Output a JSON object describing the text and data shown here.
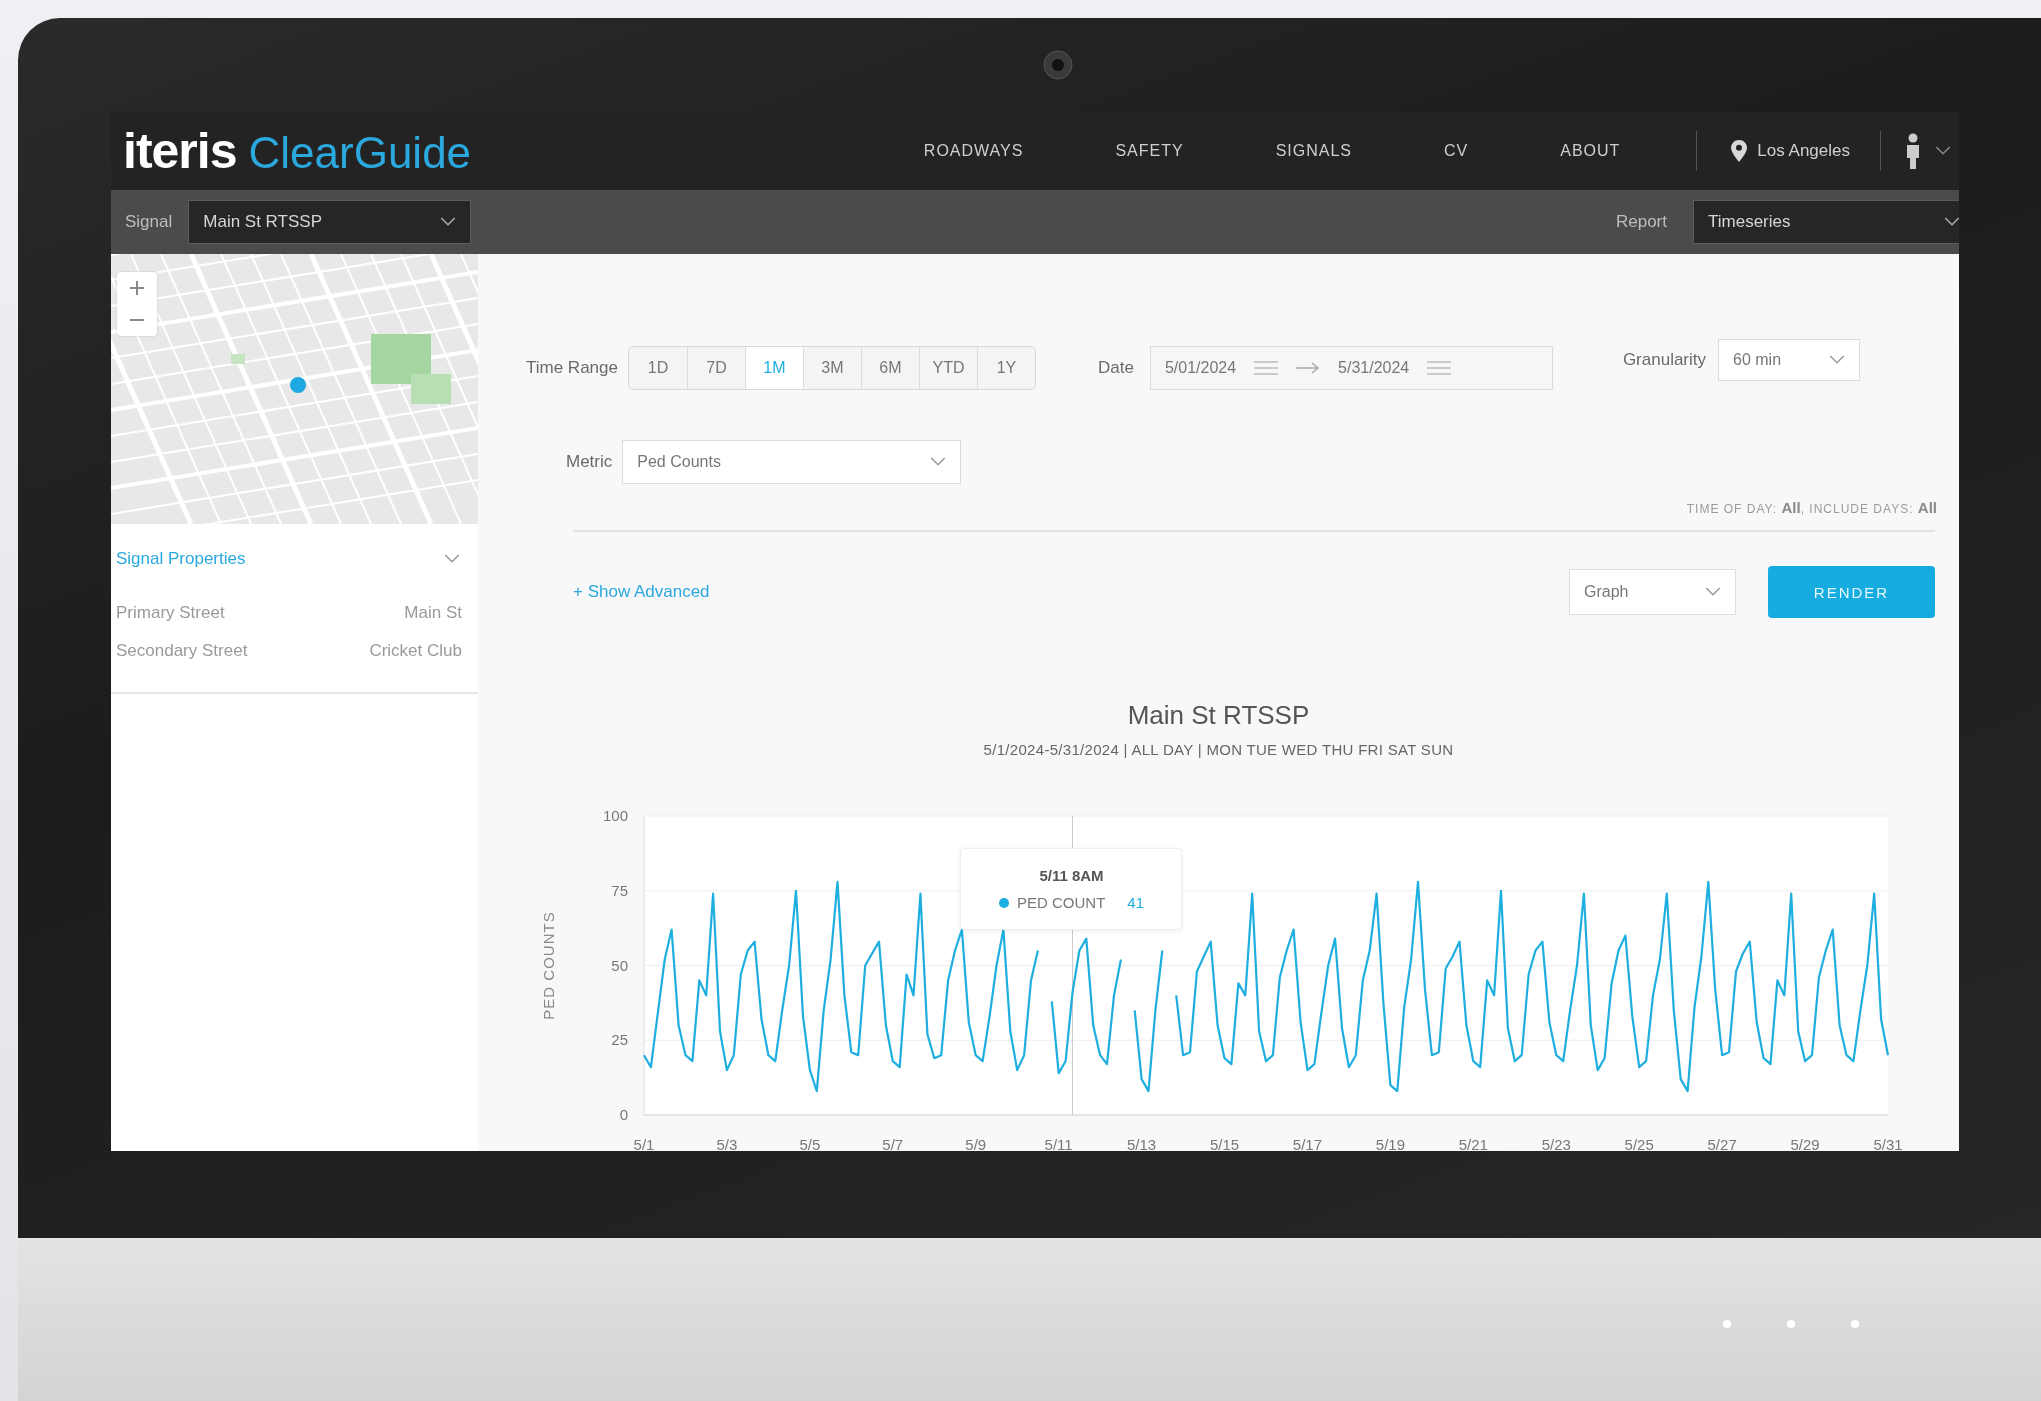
{
  "header": {
    "logo": {
      "brand": "iteris",
      "product": "ClearGuide"
    },
    "nav": [
      {
        "label": "ROADWAYS",
        "selected": false
      },
      {
        "label": "SAFETY",
        "selected": false
      },
      {
        "label": "SIGNALS",
        "selected": false
      },
      {
        "label": "CV",
        "selected": false
      },
      {
        "label": "ABOUT",
        "selected": false
      }
    ],
    "location": "Los Angeles"
  },
  "toolbar": {
    "signal": {
      "label": "Signal",
      "value": "Main St RTSSP"
    },
    "report": {
      "label": "Report",
      "value": "Timeseries"
    }
  },
  "sidebar": {
    "properties": {
      "title": "Signal Properties",
      "rows": [
        {
          "name": "Primary Street",
          "value": "Main St"
        },
        {
          "name": "Secondary Street",
          "value": "Cricket Club"
        }
      ]
    }
  },
  "controls": {
    "time_range": {
      "label": "Time Range",
      "options": [
        {
          "label": "1D",
          "selected": false
        },
        {
          "label": "7D",
          "selected": false
        },
        {
          "label": "1M",
          "selected": true
        },
        {
          "label": "3M",
          "selected": false
        },
        {
          "label": "6M",
          "selected": false
        },
        {
          "label": "YTD",
          "selected": false
        },
        {
          "label": "1Y",
          "selected": false
        }
      ]
    },
    "date": {
      "label": "Date",
      "start": "5/01/2024",
      "end": "5/31/2024"
    },
    "granularity": {
      "label": "Granularity",
      "value": "60 min"
    },
    "metric": {
      "label": "Metric",
      "value": "Ped Counts"
    },
    "filter_summary": "TIME OF DAY: **All**, INCLUDE DAYS: **All**",
    "show_advanced": "+ Show Advanced",
    "view": {
      "value": "Graph"
    },
    "render_button": "RENDER"
  },
  "chart": {
    "subtitle": "5/1/2024-5/31/2024 | ALL DAY | MON TUE WED THU FRI SAT SUN",
    "tooltip": {
      "title": "5/11 8AM",
      "value": "41"
    },
    "chart_data": {
      "type": "line",
      "title": "Main St RTSSP",
      "ylabel": "PED COUNTS",
      "grid": true,
      "ylim": [
        0,
        100
      ],
      "categories": [
        "5/1",
        null,
        null,
        null,
        null,
        null,
        null,
        null,
        null,
        null,
        null,
        null,
        "5/3",
        null,
        null,
        null,
        null,
        null,
        null,
        null,
        null,
        null,
        null,
        null,
        "5/5",
        null,
        null,
        null,
        null,
        null,
        null,
        null,
        null,
        null,
        null,
        null,
        "5/7",
        null,
        null,
        null,
        null,
        null,
        null,
        null,
        null,
        null,
        null,
        null,
        "5/9",
        null,
        null,
        null,
        null,
        null,
        null,
        null,
        null,
        null,
        null,
        null,
        "5/11",
        null,
        null,
        null,
        null,
        null,
        null,
        null,
        null,
        null,
        null,
        null,
        "5/13",
        null,
        null,
        null,
        null,
        null,
        null,
        null,
        null,
        null,
        null,
        null,
        "5/15",
        null,
        null,
        null,
        null,
        null,
        null,
        null,
        null,
        null,
        null,
        null,
        "5/17",
        null,
        null,
        null,
        null,
        null,
        null,
        null,
        null,
        null,
        null,
        null,
        "5/19",
        null,
        null,
        null,
        null,
        null,
        null,
        null,
        null,
        null,
        null,
        null,
        "5/21",
        null,
        null,
        null,
        null,
        null,
        null,
        null,
        null,
        null,
        null,
        null,
        "5/23",
        null,
        null,
        null,
        null,
        null,
        null,
        null,
        null,
        null,
        null,
        null,
        "5/25",
        null,
        null,
        null,
        null,
        null,
        null,
        null,
        null,
        null,
        null,
        null,
        "5/27",
        null,
        null,
        null,
        null,
        null,
        null,
        null,
        null,
        null,
        null,
        null,
        "5/29",
        null,
        null,
        null,
        null,
        null,
        null,
        null,
        null,
        null,
        null,
        null,
        "5/31"
      ],
      "yticks": [
        0,
        25,
        50,
        75,
        100
      ],
      "series": [
        {
          "name": "PED COUNT",
          "color": "#1eaee0",
          "values": [
            20,
            16,
            34,
            52,
            62,
            30,
            20,
            18,
            45,
            40,
            74,
            28,
            15,
            20,
            47,
            55,
            58,
            32,
            20,
            18,
            35,
            50,
            75,
            33,
            15,
            8,
            35,
            52,
            78,
            40,
            21,
            20,
            50,
            54,
            58,
            30,
            18,
            16,
            47,
            40,
            74,
            27,
            19,
            20,
            45,
            55,
            62,
            31,
            20,
            18,
            33,
            50,
            62,
            28,
            15,
            20,
            45,
            55,
            null,
            38,
            14,
            18,
            41,
            55,
            59,
            30,
            20,
            17,
            40,
            52,
            null,
            35,
            12,
            8,
            35,
            55,
            null,
            40,
            20,
            21,
            48,
            53,
            58,
            30,
            19,
            17,
            44,
            40,
            74,
            28,
            18,
            20,
            46,
            55,
            62,
            31,
            15,
            17,
            34,
            50,
            59,
            29,
            16,
            20,
            45,
            55,
            74,
            37,
            10,
            8,
            36,
            52,
            78,
            42,
            20,
            21,
            49,
            53,
            58,
            30,
            18,
            16,
            45,
            40,
            75,
            29,
            18,
            20,
            47,
            55,
            58,
            31,
            20,
            18,
            35,
            50,
            74,
            30,
            15,
            19,
            44,
            55,
            60,
            33,
            16,
            18,
            40,
            52,
            74,
            35,
            12,
            8,
            36,
            53,
            78,
            42,
            20,
            21,
            48,
            54,
            58,
            31,
            19,
            17,
            45,
            40,
            74,
            28,
            18,
            20,
            46,
            55,
            62,
            30,
            20,
            18,
            35,
            50,
            74,
            32,
            20
          ]
        }
      ]
    }
  }
}
